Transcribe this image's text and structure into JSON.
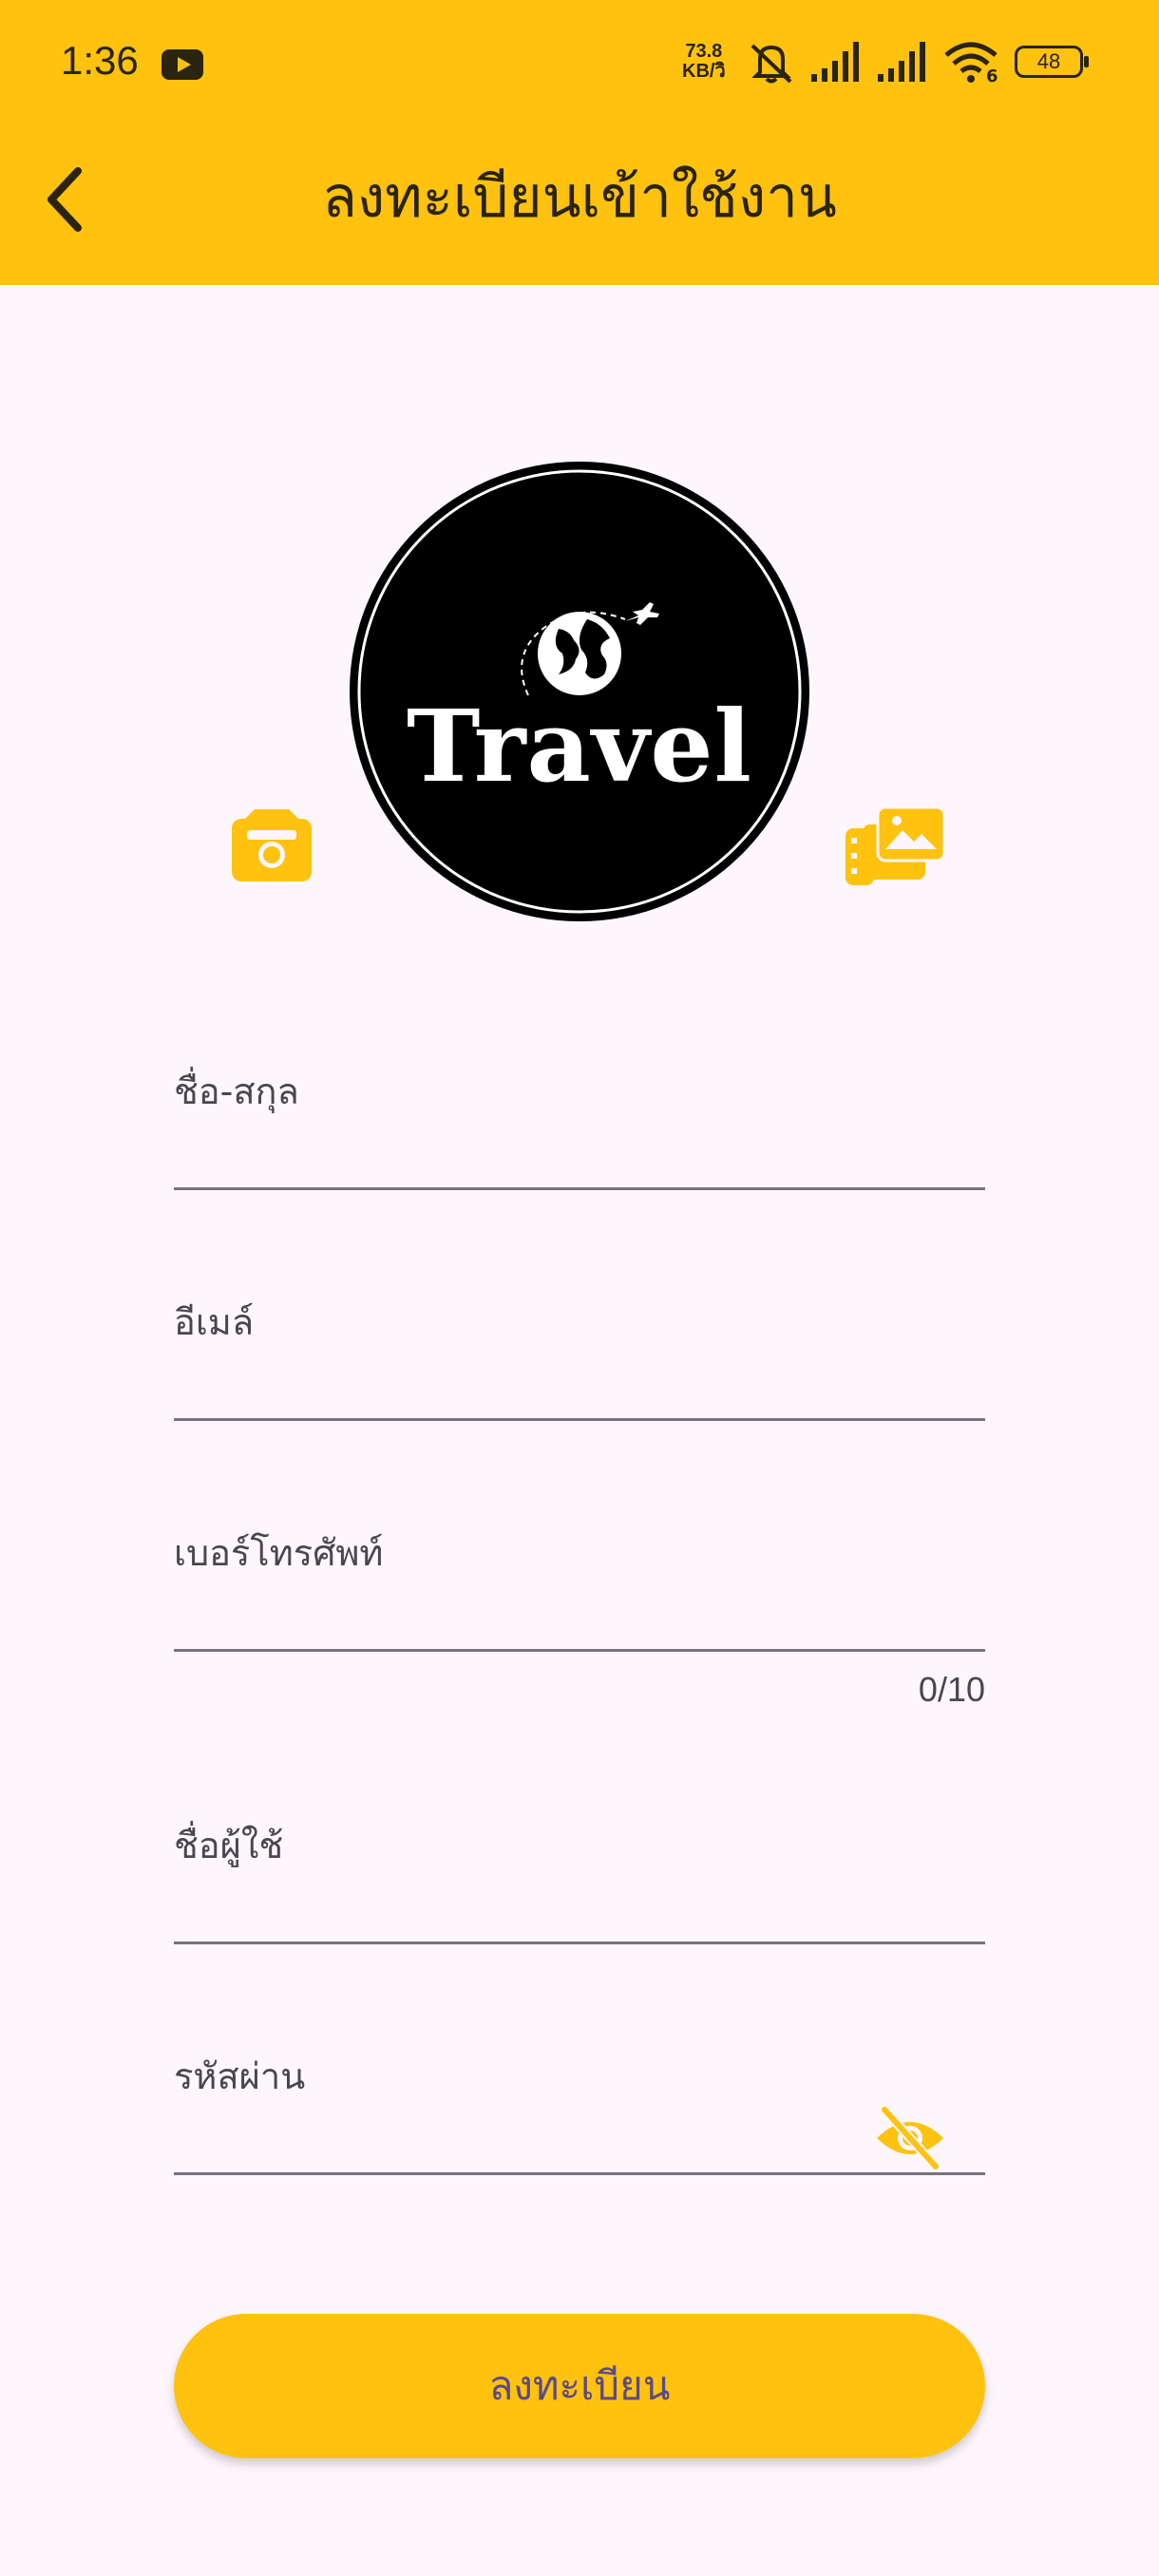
{
  "status_bar": {
    "time": "1:36",
    "net_speed_value": "73.8",
    "net_speed_unit": "KB/วิ",
    "wifi_label": "6",
    "battery": "48"
  },
  "header": {
    "title": "ลงทะเบียนเข้าใช้งาน"
  },
  "logo": {
    "text": "Travel"
  },
  "form": {
    "fullname_label": "ชื่อ-สกุล",
    "email_label": "อีเมล์",
    "phone_label": "เบอร์โทรศัพท์",
    "phone_counter": "0/10",
    "username_label": "ชื่อผู้ใช้",
    "password_label": "รหัสผ่าน",
    "fullname_value": "",
    "email_value": "",
    "phone_value": "",
    "username_value": "",
    "password_value": ""
  },
  "actions": {
    "register_label": "ลงทะเบียน"
  },
  "colors": {
    "accent": "#FEC20F",
    "background": "#FDF6FC",
    "button_text": "#5B4A86"
  },
  "icons": {
    "back": "chevron-left-icon",
    "camera": "camera-icon",
    "gallery": "gallery-icon",
    "visibility": "eye-off-icon"
  }
}
